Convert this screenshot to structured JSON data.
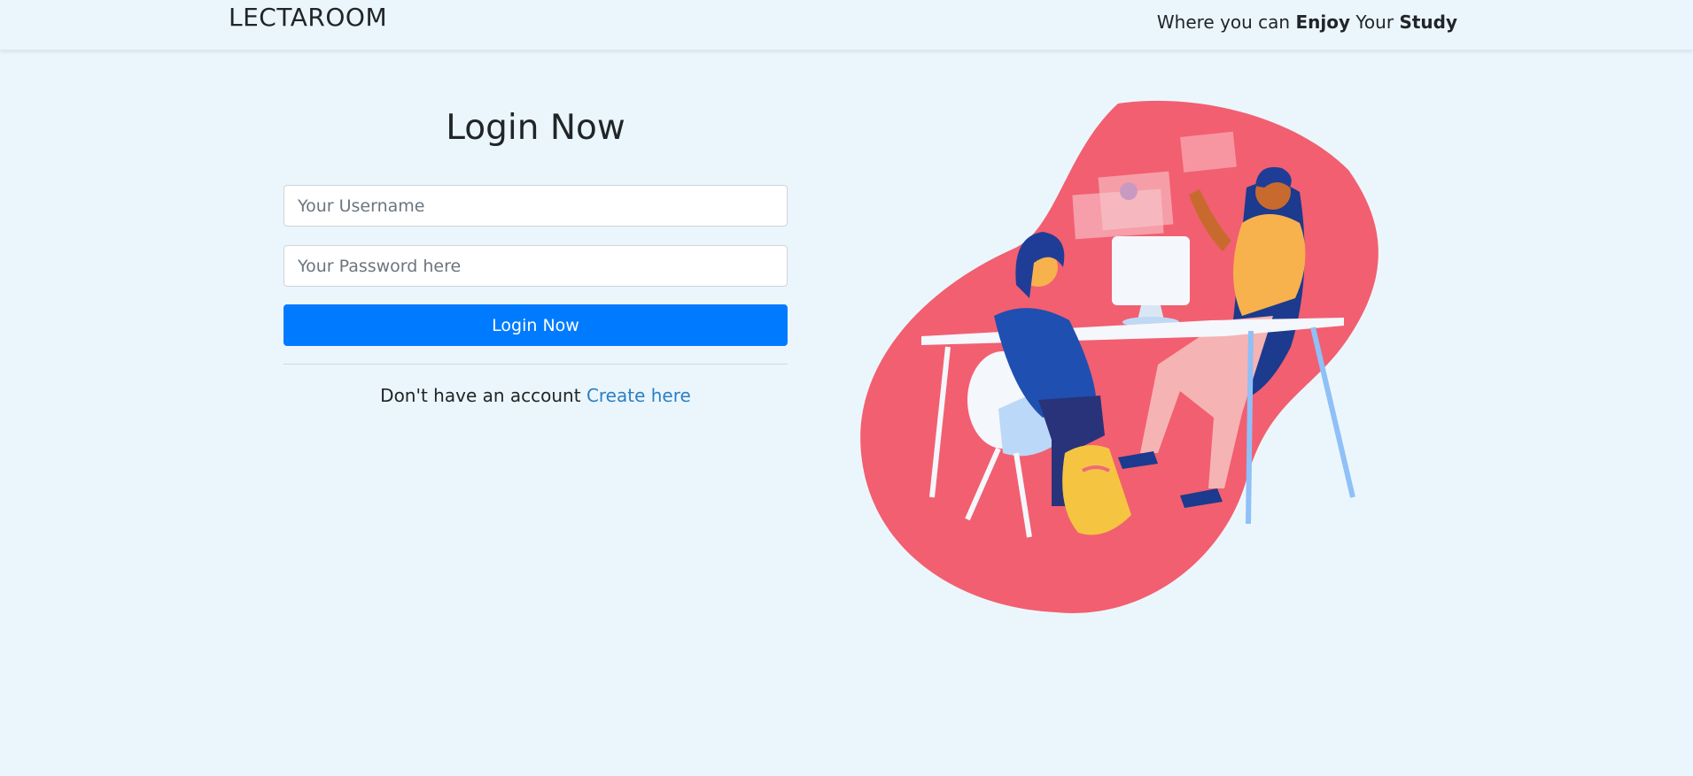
{
  "header": {
    "brand": "LECTAROOM",
    "tagline_prefix": "Where you can ",
    "tagline_enjoy": "Enjoy",
    "tagline_mid": " Your ",
    "tagline_study": "Study"
  },
  "login": {
    "title": "Login Now",
    "username_placeholder": "Your Username",
    "password_placeholder": "Your Password here",
    "submit_label": "Login Now",
    "signup_prompt": "Don't have an account ",
    "signup_link": "Create here"
  },
  "colors": {
    "background": "#ebf6fc",
    "primary": "#007bff",
    "link": "#2b7fc4",
    "illustration_blob": "#f25f70"
  }
}
